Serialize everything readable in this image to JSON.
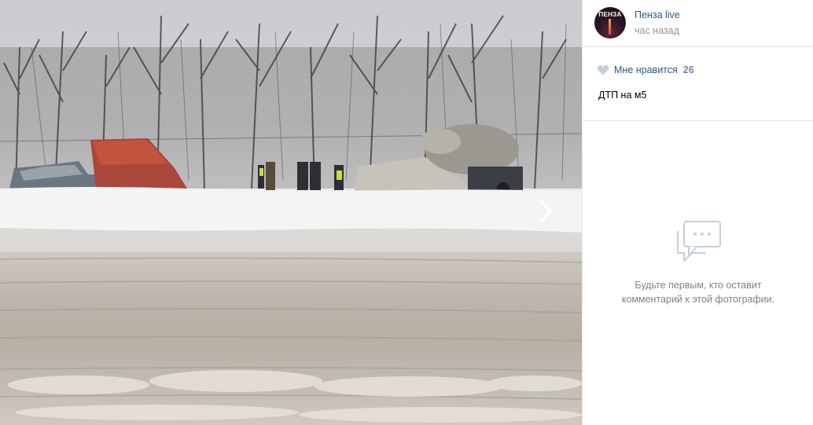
{
  "viewer": {
    "prev_icon": "chevron-left-icon",
    "next_icon": "chevron-right-icon"
  },
  "post": {
    "avatar_text": "ПЕНЗА",
    "group_name": "Пенза live",
    "time": "час назад",
    "like_label": "Мне нравится",
    "like_count": "26",
    "caption": "ДТП на м5"
  },
  "comments": {
    "empty_line1": "Будьте первым, кто оставит",
    "empty_line2": "комментарий к этой фотографии."
  },
  "colors": {
    "link": "#2a5885",
    "like_count": "#6f88a7",
    "muted": "#939393",
    "icon": "#c5d0db"
  }
}
